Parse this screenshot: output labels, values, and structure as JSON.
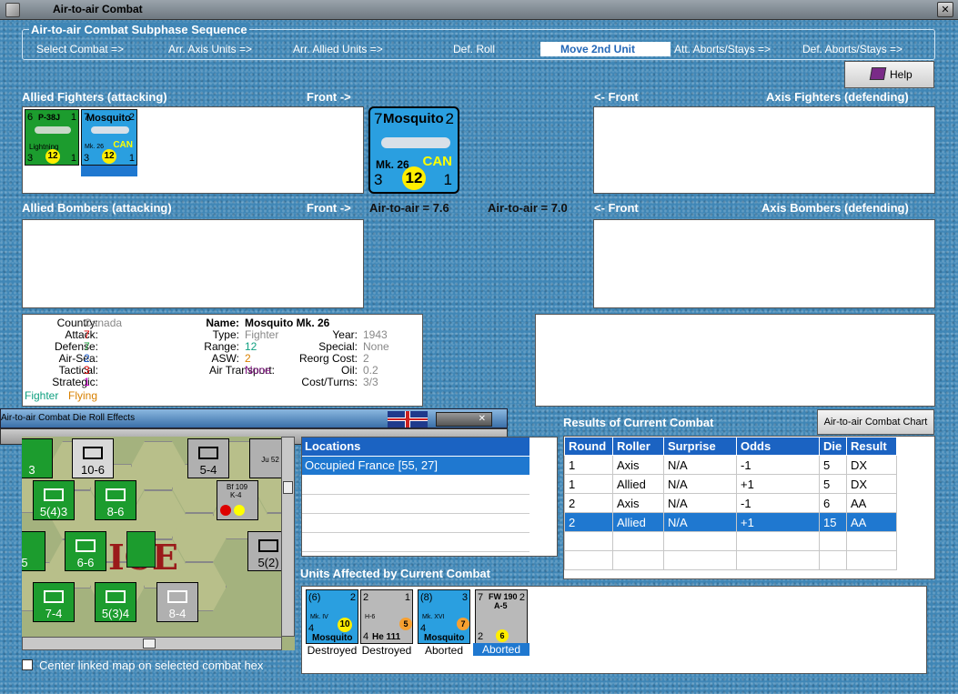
{
  "window": {
    "title": "Air-to-air Combat"
  },
  "sequence": {
    "label": "Air-to-air Combat Subphase Sequence",
    "steps": [
      "Select Combat =>",
      "Arr. Axis Units =>",
      "Arr. Allied Units =>",
      "Def. Roll",
      "Move 2nd Unit",
      "Att. Aborts/Stays =>",
      "Def. Aborts/Stays =>"
    ],
    "active_index": 4
  },
  "help_button": "Help",
  "headers": {
    "allied_fighters": "Allied Fighters (attacking)",
    "front_right": "Front ->",
    "front_left": "<- Front",
    "axis_fighters": "Axis Fighters (defending)",
    "allied_bombers": "Allied Bombers (attacking)",
    "axis_bombers": "Axis Bombers (defending)",
    "air_left": "Air-to-air = 7.6",
    "air_right": "Air-to-air = 7.0"
  },
  "allied_fighter_units": [
    {
      "att": "6",
      "name": "P-38J",
      "def": "1",
      "sub": "Lightning",
      "bl": "3",
      "range": "12",
      "br": "1"
    },
    {
      "att": "7",
      "name": "Mosquito",
      "def": "2",
      "sub": "Mk. 26",
      "nat": "CAN",
      "bl": "3",
      "range": "12",
      "br": "1"
    }
  ],
  "selected_unit": {
    "att": "7",
    "name": "Mosquito",
    "def": "2",
    "sub": "Mk. 26",
    "nat": "CAN",
    "bl": "3",
    "range": "12",
    "br": "1"
  },
  "info": {
    "country_label": "Country:",
    "country": "Canada",
    "attack_label": "Attack:",
    "attack": "7",
    "defense_label": "Defense:",
    "defense": "7",
    "airsea_label": "Air-Sea:",
    "airsea": "2",
    "tactical_label": "Tactical:",
    "tactical": "3",
    "strategic_label": "Strategic:",
    "strategic": "1",
    "status1": "Fighter",
    "status2": "Flying",
    "name_label": "Name:",
    "name": "Mosquito Mk. 26",
    "type_label": "Type:",
    "type": "Fighter",
    "range_label": "Range:",
    "range": "12",
    "asw_label": "ASW:",
    "asw": "2",
    "airtransport_label": "Air Transport:",
    "airtransport": "None",
    "year_label": "Year:",
    "year": "1943",
    "special_label": "Special:",
    "special": "None",
    "reorg_label": "Reorg Cost:",
    "reorg": "2",
    "oil_label": "Oil:",
    "oil": "0.2",
    "costturns_label": "Cost/Turns:",
    "costturns": "3/3"
  },
  "die_window": {
    "title": "Air-to-air Combat Die Roll Effects"
  },
  "locations": {
    "header": "Locations",
    "items": [
      "Occupied France [55, 27]"
    ]
  },
  "results": {
    "title": "Results of Current Combat",
    "chart_button": "Air-to-air Combat Chart",
    "columns": [
      "Round",
      "Roller",
      "Surprise",
      "Odds",
      "Die",
      "Result"
    ],
    "rows": [
      [
        "1",
        "Axis",
        "N/A",
        "-1",
        "5",
        "DX"
      ],
      [
        "1",
        "Allied",
        "N/A",
        "+1",
        "5",
        "DX"
      ],
      [
        "2",
        "Axis",
        "N/A",
        "-1",
        "6",
        "AA"
      ],
      [
        "2",
        "Allied",
        "N/A",
        "+1",
        "15",
        "AA"
      ]
    ]
  },
  "affected": {
    "title": "Units Affected by Current Combat",
    "units": [
      {
        "top": "(6)",
        "tr": "2",
        "sub": "Mk. IV",
        "bl": "4",
        "range": "10",
        "name": "Mosquito",
        "status": "Destroyed"
      },
      {
        "top": "2",
        "tr": "1",
        "sub": "H-6",
        "bl": "4",
        "range": "5",
        "name": "He 111",
        "status": "Destroyed"
      },
      {
        "top": "(8)",
        "tr": "3",
        "sub": "Mk. XVI",
        "bl": "4",
        "range": "7",
        "name": "Mosquito",
        "status": "Aborted"
      },
      {
        "top": "7",
        "tr": "2",
        "name": "FW 190",
        "sub": "A-5",
        "bl": "2",
        "range": "6",
        "status": "Aborted"
      }
    ]
  },
  "map": {
    "france_label": "ICE",
    "units": [
      {
        "label": "10-6"
      },
      {
        "label": "5-4"
      },
      {
        "label": "5(4)3"
      },
      {
        "label": "8-6"
      },
      {
        "label": "6-6"
      },
      {
        "label": "7-4"
      },
      {
        "label": "5(3)4"
      },
      {
        "label": "8-4"
      },
      {
        "label": "5(2)"
      },
      {
        "label": "3"
      },
      {
        "label": "5"
      },
      {
        "label": "Ju 52"
      },
      {
        "label": "Bf 109"
      },
      {
        "label": "K-4"
      }
    ]
  },
  "center_map_checkbox": "Center linked map on selected combat hex"
}
